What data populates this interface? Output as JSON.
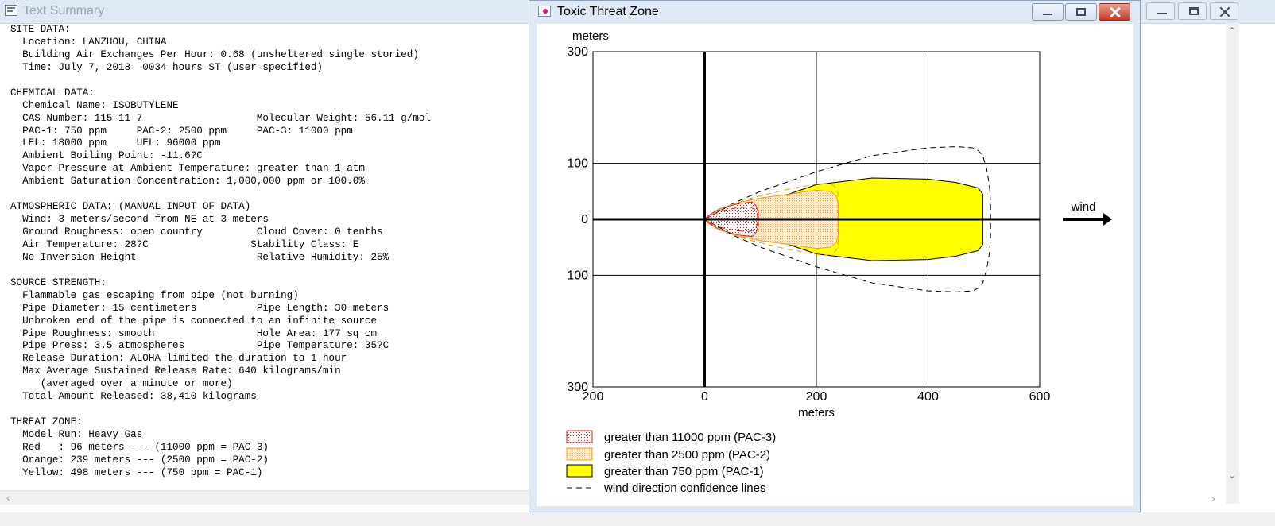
{
  "summary": {
    "title": "Text Summary",
    "lines": [
      "SITE DATA:",
      "  Location: LANZHOU, CHINA",
      "  Building Air Exchanges Per Hour: 0.68 (unsheltered single storied)",
      "  Time: July 7, 2018  0034 hours ST (user specified)",
      "",
      "CHEMICAL DATA:",
      "  Chemical Name: ISOBUTYLENE",
      "  CAS Number: 115-11-7                   Molecular Weight: 56.11 g/mol",
      "  PAC-1: 750 ppm     PAC-2: 2500 ppm     PAC-3: 11000 ppm",
      "  LEL: 18000 ppm     UEL: 96000 ppm",
      "  Ambient Boiling Point: -11.6?C",
      "  Vapor Pressure at Ambient Temperature: greater than 1 atm",
      "  Ambient Saturation Concentration: 1,000,000 ppm or 100.0%",
      "",
      "ATMOSPHERIC DATA: (MANUAL INPUT OF DATA)",
      "  Wind: 3 meters/second from NE at 3 meters",
      "  Ground Roughness: open country         Cloud Cover: 0 tenths",
      "  Air Temperature: 28?C                 Stability Class: E",
      "  No Inversion Height                    Relative Humidity: 25%",
      "",
      "SOURCE STRENGTH:",
      "  Flammable gas escaping from pipe (not burning)",
      "  Pipe Diameter: 15 centimeters          Pipe Length: 30 meters",
      "  Unbroken end of the pipe is connected to an infinite source",
      "  Pipe Roughness: smooth                 Hole Area: 177 sq cm",
      "  Pipe Press: 3.5 atmospheres            Pipe Temperature: 35?C",
      "  Release Duration: ALOHA limited the duration to 1 hour",
      "  Max Average Sustained Release Rate: 640 kilograms/min",
      "     (averaged over a minute or more)",
      "  Total Amount Released: 38,410 kilograms",
      "",
      "THREAT ZONE:",
      "  Model Run: Heavy Gas",
      "  Red   : 96 meters --- (11000 ppm = PAC-3)",
      "  Orange: 239 meters --- (2500 ppm = PAC-2)",
      "  Yellow: 498 meters --- (750 ppm = PAC-1)"
    ],
    "scroll_left_icon": "chevron-left-icon"
  },
  "threat_window": {
    "title": "Toxic Threat Zone",
    "icon": "threat-zone-app-icon",
    "minimize_icon": "minimize-icon",
    "maximize_icon": "maximize-icon",
    "close_icon": "close-icon"
  },
  "chart_data": {
    "type": "area",
    "ylabel": "meters",
    "xlabel": "meters",
    "xlim": [
      -200,
      600
    ],
    "ylim": [
      -300,
      300
    ],
    "x_ticks": [
      -200,
      0,
      200,
      400,
      600
    ],
    "x_tick_labels": [
      "200",
      "0",
      "200",
      "400",
      "600"
    ],
    "y_ticks": [
      300,
      100,
      0,
      -100,
      -300
    ],
    "y_tick_labels": [
      "300",
      "100",
      "0",
      "100",
      "300"
    ],
    "grid": true,
    "wind_label": "wind",
    "wind_direction": "right",
    "zones": [
      {
        "name": "greater than 750 ppm (PAC-1)",
        "color": "#ffff00",
        "border": "#000000",
        "fill_style": "solid",
        "length": 498,
        "top_edge": [
          [
            0,
            0
          ],
          [
            5,
            5
          ],
          [
            20,
            13
          ],
          [
            50,
            22
          ],
          [
            100,
            35
          ],
          [
            150,
            45
          ],
          [
            200,
            62
          ],
          [
            300,
            74
          ],
          [
            400,
            72
          ],
          [
            450,
            66
          ],
          [
            490,
            56
          ],
          [
            498,
            45
          ]
        ],
        "bottom_edge": [
          [
            498,
            -45
          ],
          [
            490,
            -56
          ],
          [
            450,
            -66
          ],
          [
            400,
            -72
          ],
          [
            300,
            -74
          ],
          [
            200,
            -62
          ],
          [
            150,
            -45
          ],
          [
            100,
            -35
          ],
          [
            50,
            -22
          ],
          [
            20,
            -13
          ],
          [
            5,
            -5
          ],
          [
            0,
            0
          ]
        ]
      },
      {
        "name": "greater than 2500 ppm (PAC-2)",
        "color": "#fce4c4",
        "border": "#f0a020",
        "fill_style": "dotted",
        "length": 239,
        "top_edge": [
          [
            0,
            0
          ],
          [
            5,
            6
          ],
          [
            25,
            18
          ],
          [
            60,
            30
          ],
          [
            100,
            38
          ],
          [
            150,
            45
          ],
          [
            200,
            52
          ],
          [
            225,
            50
          ],
          [
            235,
            42
          ],
          [
            239,
            30
          ]
        ],
        "bottom_edge": [
          [
            239,
            -30
          ],
          [
            235,
            -42
          ],
          [
            225,
            -50
          ],
          [
            200,
            -52
          ],
          [
            150,
            -45
          ],
          [
            100,
            -38
          ],
          [
            60,
            -30
          ],
          [
            25,
            -18
          ],
          [
            5,
            -6
          ],
          [
            0,
            0
          ]
        ]
      },
      {
        "name": "greater than 11000 ppm (PAC-3)",
        "color": "#fdf2f2",
        "border": "#e02020",
        "fill_style": "dotted",
        "length": 96,
        "top_edge": [
          [
            0,
            0
          ],
          [
            3,
            3
          ],
          [
            12,
            10
          ],
          [
            30,
            20
          ],
          [
            60,
            28
          ],
          [
            85,
            31
          ],
          [
            92,
            24
          ],
          [
            96,
            12
          ],
          [
            96,
            0
          ]
        ],
        "bottom_edge": [
          [
            96,
            0
          ],
          [
            96,
            -12
          ],
          [
            92,
            -24
          ],
          [
            85,
            -31
          ],
          [
            60,
            -28
          ],
          [
            30,
            -20
          ],
          [
            12,
            -10
          ],
          [
            3,
            -3
          ],
          [
            0,
            0
          ]
        ]
      }
    ],
    "confidence_lines": {
      "name": "wind direction confidence lines",
      "style": "dashed",
      "outer": [
        [
          0,
          0
        ],
        [
          50,
          28
        ],
        [
          100,
          50
        ],
        [
          200,
          85
        ],
        [
          300,
          114
        ],
        [
          400,
          128
        ],
        [
          450,
          130
        ],
        [
          480,
          128
        ],
        [
          490,
          123
        ],
        [
          498,
          114
        ],
        [
          505,
          90
        ],
        [
          510,
          60
        ],
        [
          512,
          30
        ],
        [
          512,
          -30
        ],
        [
          510,
          -60
        ],
        [
          505,
          -90
        ],
        [
          498,
          -114
        ],
        [
          490,
          -123
        ],
        [
          480,
          -128
        ],
        [
          450,
          -130
        ],
        [
          400,
          -128
        ],
        [
          300,
          -114
        ],
        [
          200,
          -85
        ],
        [
          100,
          -50
        ],
        [
          50,
          -28
        ],
        [
          0,
          0
        ]
      ],
      "orange": [
        [
          0,
          0
        ],
        [
          30,
          20
        ],
        [
          80,
          37
        ],
        [
          150,
          54
        ],
        [
          200,
          63
        ],
        [
          220,
          64
        ],
        [
          232,
          60
        ],
        [
          238,
          50
        ],
        [
          240,
          20
        ],
        [
          240,
          -20
        ],
        [
          238,
          -50
        ],
        [
          232,
          -60
        ],
        [
          220,
          -64
        ],
        [
          200,
          -63
        ],
        [
          150,
          -54
        ],
        [
          80,
          -37
        ],
        [
          30,
          -20
        ],
        [
          0,
          0
        ]
      ],
      "red": [
        [
          0,
          0
        ],
        [
          10,
          7
        ],
        [
          30,
          15
        ],
        [
          55,
          20
        ],
        [
          80,
          22
        ],
        [
          90,
          18
        ],
        [
          94,
          10
        ],
        [
          95,
          0
        ],
        [
          94,
          -10
        ],
        [
          90,
          -18
        ],
        [
          80,
          -22
        ],
        [
          55,
          -20
        ],
        [
          30,
          -15
        ],
        [
          10,
          -7
        ],
        [
          0,
          0
        ]
      ]
    },
    "legend": [
      {
        "label": "greater than 11000 ppm (PAC-3)",
        "swatch": "red-dotted"
      },
      {
        "label": "greater than 2500 ppm (PAC-2)",
        "swatch": "orange-dotted"
      },
      {
        "label": "greater than 750 ppm (PAC-1)",
        "swatch": "yellow-solid"
      },
      {
        "label": "wind direction confidence lines",
        "swatch": "dashed-line"
      }
    ]
  },
  "right_window": {
    "minimize_icon": "minimize-icon",
    "maximize_icon": "maximize-icon",
    "close_icon": "close-icon",
    "scroll_up_icon": "chevron-up-icon",
    "scroll_down_icon": "chevron-down-icon",
    "scroll_right_icon": "chevron-right-icon"
  }
}
